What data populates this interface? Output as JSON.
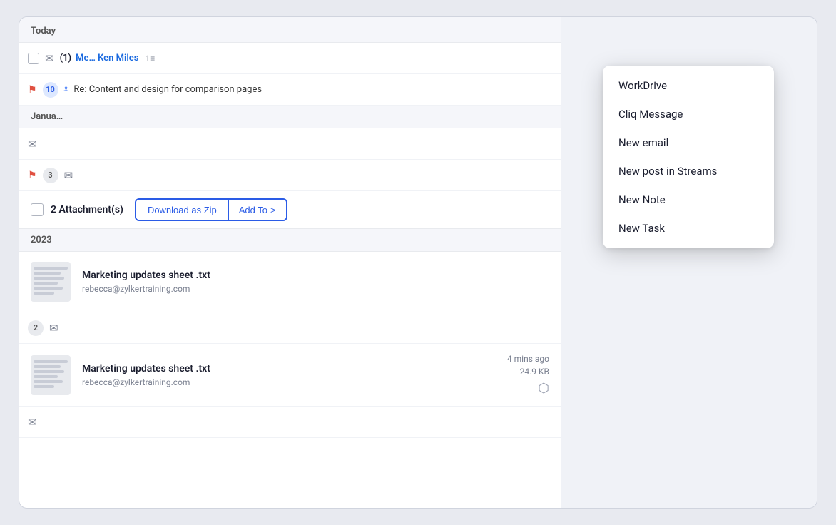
{
  "sections": {
    "today": "Today",
    "january": "Janua…",
    "year2023": "2023"
  },
  "emailRows": [
    {
      "id": "email-1",
      "checkbox": true,
      "icon": "email",
      "badge": "(1)",
      "sender": "Me… Ken Miles",
      "count": "1≡",
      "subject": ""
    },
    {
      "id": "email-2",
      "flag": true,
      "badge": "10",
      "icon": "wave",
      "subject": "Re: Content and design for comparison pages"
    }
  ],
  "januaryRows": [
    {
      "id": "jan-1",
      "icon": "email",
      "badge": ""
    },
    {
      "id": "jan-2",
      "icon": "email",
      "badge": "3"
    }
  ],
  "year2023Rows": [
    {
      "id": "y23-1",
      "icon": "email",
      "badge": "2"
    },
    {
      "id": "y23-2",
      "icon": "email",
      "badge": ""
    }
  ],
  "attachmentBar": {
    "checkboxLabel": "2 Attachment(s)",
    "downloadBtn": "Download as Zip",
    "addBtn": "Add To",
    "addChevron": ">"
  },
  "files": [
    {
      "id": "file-1",
      "name": "Marketing updates sheet .txt",
      "email": "rebecca@zylkertraining.com",
      "time": "",
      "size": ""
    },
    {
      "id": "file-2",
      "name": "Marketing updates sheet .txt",
      "email": "rebecca@zylkertraining.com",
      "time": "4 mins ago",
      "size": "24.9 KB"
    }
  ],
  "dropdown": {
    "items": [
      {
        "id": "workdrive",
        "label": "WorkDrive"
      },
      {
        "id": "cliq",
        "label": "Cliq Message"
      },
      {
        "id": "new-email",
        "label": "New email"
      },
      {
        "id": "streams",
        "label": "New post in Streams"
      },
      {
        "id": "new-note",
        "label": "New Note"
      },
      {
        "id": "new-task",
        "label": "New Task"
      }
    ]
  }
}
